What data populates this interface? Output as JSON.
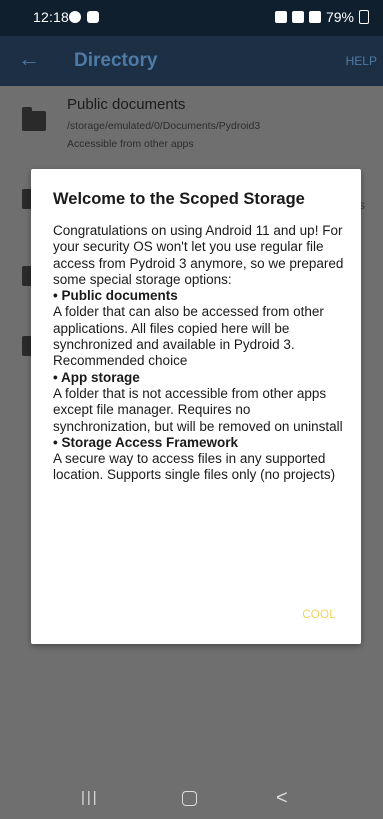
{
  "status_bar": {
    "time": "12:18",
    "battery": "79%"
  },
  "app_bar": {
    "back_icon": "←",
    "title": "Directory",
    "help": "HELP"
  },
  "list": {
    "items": [
      {
        "name": "Public documents",
        "path": "/storage/emulated/0/Documents/Pydroid3",
        "description": "Accessible from other apps"
      }
    ],
    "fragment": "s"
  },
  "dialog": {
    "title": "Welcome to the Scoped Storage",
    "intro": "Congratulations on using Android 11 and up! For your security OS won't let you use regular file access from Pydroid 3 anymore, so we prepared some special storage options:",
    "options": [
      {
        "heading": "• Public documents",
        "text": "A folder that can also be accessed from other applications. All files copied here will be synchronized and available in Pydroid 3. Recommended choice"
      },
      {
        "heading": "• App storage",
        "text": "A folder that is not accessible from other apps except file manager. Requires no synchronization, but will be removed on uninstall"
      },
      {
        "heading": "• Storage Access Framework",
        "text": "A secure way to access files in any supported location. Supports single files only (no projects)"
      }
    ],
    "button": "COOL"
  },
  "nav_bar": {
    "recents": "|||",
    "back": "<"
  },
  "colors": {
    "app_bar": "#1d2f45",
    "accent_button": "#f2d35e",
    "status_bar": "#0f1f2d"
  }
}
